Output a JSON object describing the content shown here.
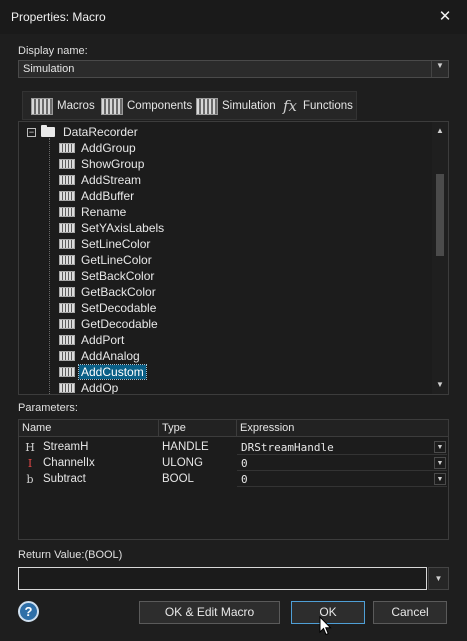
{
  "window": {
    "title": "Properties: Macro",
    "close_glyph": "✕"
  },
  "display_name": {
    "label": "Display name:",
    "value": "Simulation"
  },
  "tabs": [
    {
      "label": "Macros",
      "icon": "macro-icon"
    },
    {
      "label": "Components",
      "icon": "component-icon"
    },
    {
      "label": "Simulation",
      "icon": "simulation-icon"
    },
    {
      "label": "Functions",
      "icon": "fx-icon"
    }
  ],
  "tree": {
    "root": "DataRecorder",
    "expander": "−",
    "items": [
      "AddGroup",
      "ShowGroup",
      "AddStream",
      "AddBuffer",
      "Rename",
      "SetYAxisLabels",
      "SetLineColor",
      "GetLineColor",
      "SetBackColor",
      "GetBackColor",
      "SetDecodable",
      "GetDecodable",
      "AddPort",
      "AddAnalog",
      "AddCustom",
      "AddOp"
    ],
    "selected": "AddCustom"
  },
  "parameters": {
    "label": "Parameters:",
    "headers": {
      "name": "Name",
      "type": "Type",
      "expression": "Expression"
    },
    "rows": [
      {
        "name": "StreamH",
        "type": "HANDLE",
        "expression": "DRStreamHandle",
        "icon": "H",
        "icon_color": "#d0d0d0"
      },
      {
        "name": "ChannelIx",
        "type": "ULONG",
        "expression": "0",
        "icon": "I",
        "icon_color": "#e04646"
      },
      {
        "name": "Subtract",
        "type": "BOOL",
        "expression": "0",
        "icon": "b",
        "icon_color": "#d0d0d0"
      }
    ]
  },
  "return_value": {
    "label": "Return Value:(BOOL)",
    "value": ""
  },
  "buttons": {
    "help": "?",
    "ok_edit": "OK & Edit Macro",
    "ok": "OK",
    "cancel": "Cancel"
  },
  "colors": {
    "selection": "#0a5f87",
    "default_button_border": "#4f9fd6",
    "background": "#1e1e1e"
  }
}
